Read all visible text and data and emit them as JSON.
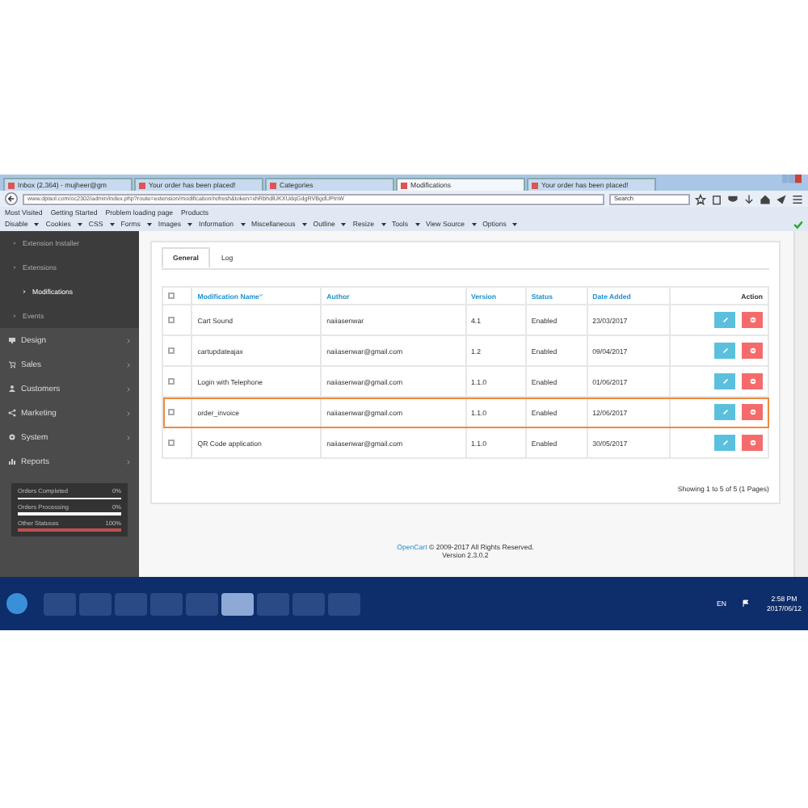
{
  "browser": {
    "tabs": [
      {
        "title": "Inbox (2,364) - mujheer@gm",
        "selected": false
      },
      {
        "title": "Your order has been placed!",
        "selected": false
      },
      {
        "title": "Categories",
        "selected": false
      },
      {
        "title": "Modifications",
        "selected": true
      },
      {
        "title": "Your order has been placed!",
        "selected": false
      }
    ],
    "url": "www.dpisol.com/oc2302/admin/index.php?route=extension/modification/refresh&token=xhRbhdlUKXUdqGdgRVBgdUPInW",
    "search_placeholder": "Search",
    "bookmarks": [
      "Most Visited",
      "Getting Started",
      "Problem loading page",
      "Products"
    ],
    "dev_toolbar": [
      "Disable",
      "Cookies",
      "CSS",
      "Forms",
      "Images",
      "Information",
      "Miscellaneous",
      "Outline",
      "Resize",
      "Tools",
      "View Source",
      "Options"
    ]
  },
  "sidebar": {
    "submenu": [
      {
        "label": "Extension Installer",
        "selected": false
      },
      {
        "label": "Extensions",
        "selected": false,
        "children": [
          {
            "label": "Modifications",
            "selected": true
          }
        ]
      },
      {
        "label": "Events",
        "selected": false
      }
    ],
    "menu": [
      "Design",
      "Sales",
      "Customers",
      "Marketing",
      "System",
      "Reports"
    ],
    "stats": [
      {
        "label": "Orders Completed",
        "reading": "0%",
        "color": "#ffffff"
      },
      {
        "label": "Orders Processing",
        "reading": "0%",
        "color": "#ffffff"
      },
      {
        "label": "Other Statuses",
        "reading": "100%",
        "color": "#c0504d"
      }
    ]
  },
  "content": {
    "tabs": [
      {
        "label": "General",
        "selected": true
      },
      {
        "label": "Log",
        "selected": false
      }
    ],
    "table": {
      "select_all_checked": false,
      "columns": [
        "Modification Name",
        "Author",
        "Version",
        "Status",
        "Date Added",
        "Action"
      ],
      "rows": [
        {
          "name": "Cart Sound",
          "author": "naiiasenwar",
          "version": "4.1",
          "status": "Enabled",
          "date_added": "23/03/2017",
          "checked": false,
          "highlighted": false
        },
        {
          "name": "cartupdateajax",
          "author": "naiiasenwar@gmail.com",
          "version": "1.2",
          "status": "Enabled",
          "date_added": "09/04/2017",
          "checked": false,
          "highlighted": false
        },
        {
          "name": "Login with Telephone",
          "author": "naiiasenwar@gmail.com",
          "version": "1.1.0",
          "status": "Enabled",
          "date_added": "01/06/2017",
          "checked": false,
          "highlighted": false
        },
        {
          "name": "order_invoice",
          "author": "naiiasenwar@gmail.com",
          "version": "1.1.0",
          "status": "Enabled",
          "date_added": "12/06/2017",
          "checked": false,
          "highlighted": true
        },
        {
          "name": "QR Code application",
          "author": "naiiasenwar@gmail.com",
          "version": "1.1.0",
          "status": "Enabled",
          "date_added": "30/05/2017",
          "checked": false,
          "highlighted": false
        }
      ]
    },
    "pagination": "Showing 1 to 5 of 5 (1 Pages)"
  },
  "footer": {
    "brand": "OpenCart",
    "copyright": "© 2009-2017 All Rights Reserved.",
    "version": "Version 2.3.0.2"
  },
  "taskbar": {
    "apps": [
      {
        "selected": false
      },
      {
        "selected": false
      },
      {
        "selected": false
      },
      {
        "selected": false
      },
      {
        "selected": false
      },
      {
        "selected": true
      },
      {
        "selected": false
      },
      {
        "selected": false
      },
      {
        "selected": false
      }
    ],
    "language": "EN",
    "time": "2:58 PM",
    "date": "2017/06/12"
  }
}
